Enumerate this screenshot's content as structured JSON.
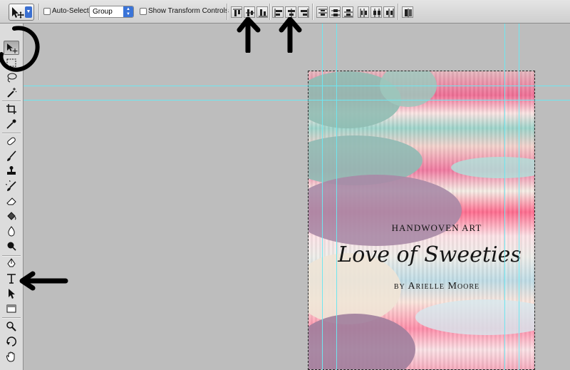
{
  "options_bar": {
    "tool_preset_icon": "move-tool-icon",
    "auto_select_label": "Auto-Select:",
    "auto_select_checked": false,
    "auto_select_mode": "Group",
    "show_transform_label": "Show Transform Controls",
    "show_transform_checked": false,
    "align_icons": [
      "align-top-edges-icon",
      "align-vertical-centers-icon",
      "align-bottom-edges-icon",
      "align-left-edges-icon",
      "align-horizontal-centers-icon",
      "align-right-edges-icon"
    ],
    "distribute_icons": [
      "distribute-top-icon",
      "distribute-vertical-center-icon",
      "distribute-bottom-icon",
      "distribute-left-icon",
      "distribute-horizontal-center-icon",
      "distribute-right-icon"
    ],
    "auto_align_icon": "auto-align-layers-icon"
  },
  "tools": [
    "move-tool-icon",
    "marquee-tool-icon",
    "lasso-tool-icon",
    "magic-wand-tool-icon",
    "crop-tool-icon",
    "eyedropper-tool-icon",
    "healing-brush-tool-icon",
    "brush-tool-icon",
    "clone-stamp-tool-icon",
    "history-brush-tool-icon",
    "eraser-tool-icon",
    "paint-bucket-tool-icon",
    "blur-tool-icon",
    "dodge-tool-icon",
    "pen-tool-icon",
    "type-tool-icon",
    "path-selection-tool-icon",
    "rectangle-tool-icon",
    "zoom-tool-icon",
    "rotate-view-tool-icon",
    "hand-tool-icon"
  ],
  "document": {
    "line1": "HANDWOVEN ART",
    "line2": "Love of Sweeties",
    "line3": "by Arielle Moore"
  },
  "colors": {
    "guide": "#6fe6f0",
    "accent_select": "#3a74d8"
  }
}
